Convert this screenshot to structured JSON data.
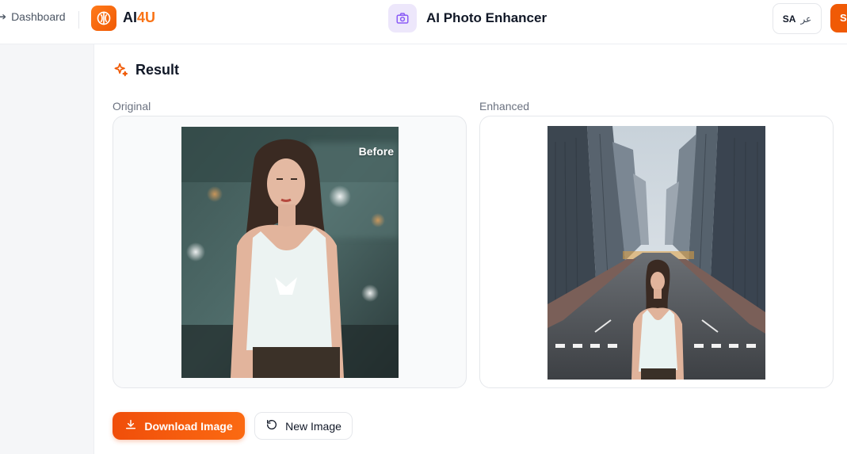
{
  "nav": {
    "back_label": "Dashboard"
  },
  "brand": {
    "prefix": "AI",
    "suffix": "4U"
  },
  "tool": {
    "title": "AI Photo Enhancer",
    "icon": "camera-icon"
  },
  "language": {
    "code": "SA",
    "label": "عر"
  },
  "account": {
    "signin_label": "S"
  },
  "result": {
    "title": "Result",
    "original_label": "Original",
    "enhanced_label": "Enhanced",
    "before_badge": "Before"
  },
  "actions": {
    "download_label": "Download Image",
    "new_label": "New Image"
  },
  "colors": {
    "accent": "#f05a05",
    "tool_icon_bg": "#ede7fb"
  }
}
